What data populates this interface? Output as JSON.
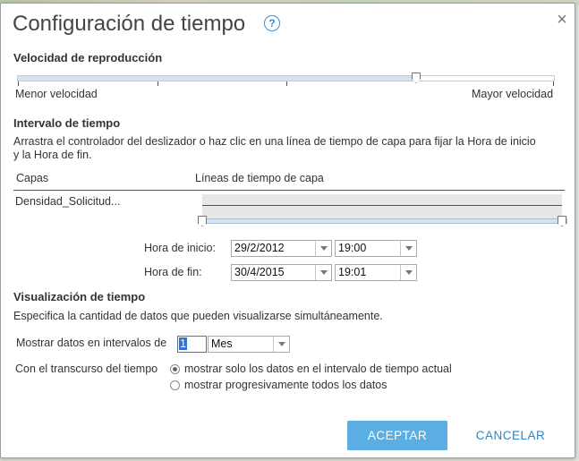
{
  "dialog": {
    "title": "Configuración de tiempo",
    "help_symbol": "?",
    "close_symbol": "×"
  },
  "playback": {
    "heading": "Velocidad de reproducción",
    "min_label": "Menor velocidad",
    "max_label": "Mayor velocidad",
    "value_fraction": 0.74
  },
  "interval": {
    "heading": "Intervalo de tiempo",
    "description_line1": "Arrastra el controlador del deslizador o haz clic en una línea de tiempo de capa para fijar la Hora de inicio",
    "description_line2": "y la Hora de fin.",
    "col_layers": "Capas",
    "col_timelines": "Líneas de tiempo de capa",
    "layer_name": "Densidad_Solicitud...",
    "start_label": "Hora de inicio:",
    "start_date": "29/2/2012",
    "start_time": "19:00",
    "end_label": "Hora de fin:",
    "end_date": "30/4/2015",
    "end_time": "19:01"
  },
  "display": {
    "heading": "Visualización de tiempo",
    "description": "Especifica la cantidad de datos que pueden visualizarse simultáneamente.",
    "interval_label": "Mostrar datos en intervalos de",
    "interval_value": "1",
    "interval_unit": "Mes",
    "over_time_label": "Con el transcurso del tiempo",
    "option_current": "mostrar solo los datos en el intervalo de tiempo actual",
    "option_cumulative": "mostrar progresivamente todos los datos"
  },
  "buttons": {
    "accept": "ACEPTAR",
    "cancel": "CANCELAR"
  },
  "colors": {
    "accent": "#5aaee3",
    "link": "#2b86c8",
    "slider_fill": "#d2e2f3"
  }
}
